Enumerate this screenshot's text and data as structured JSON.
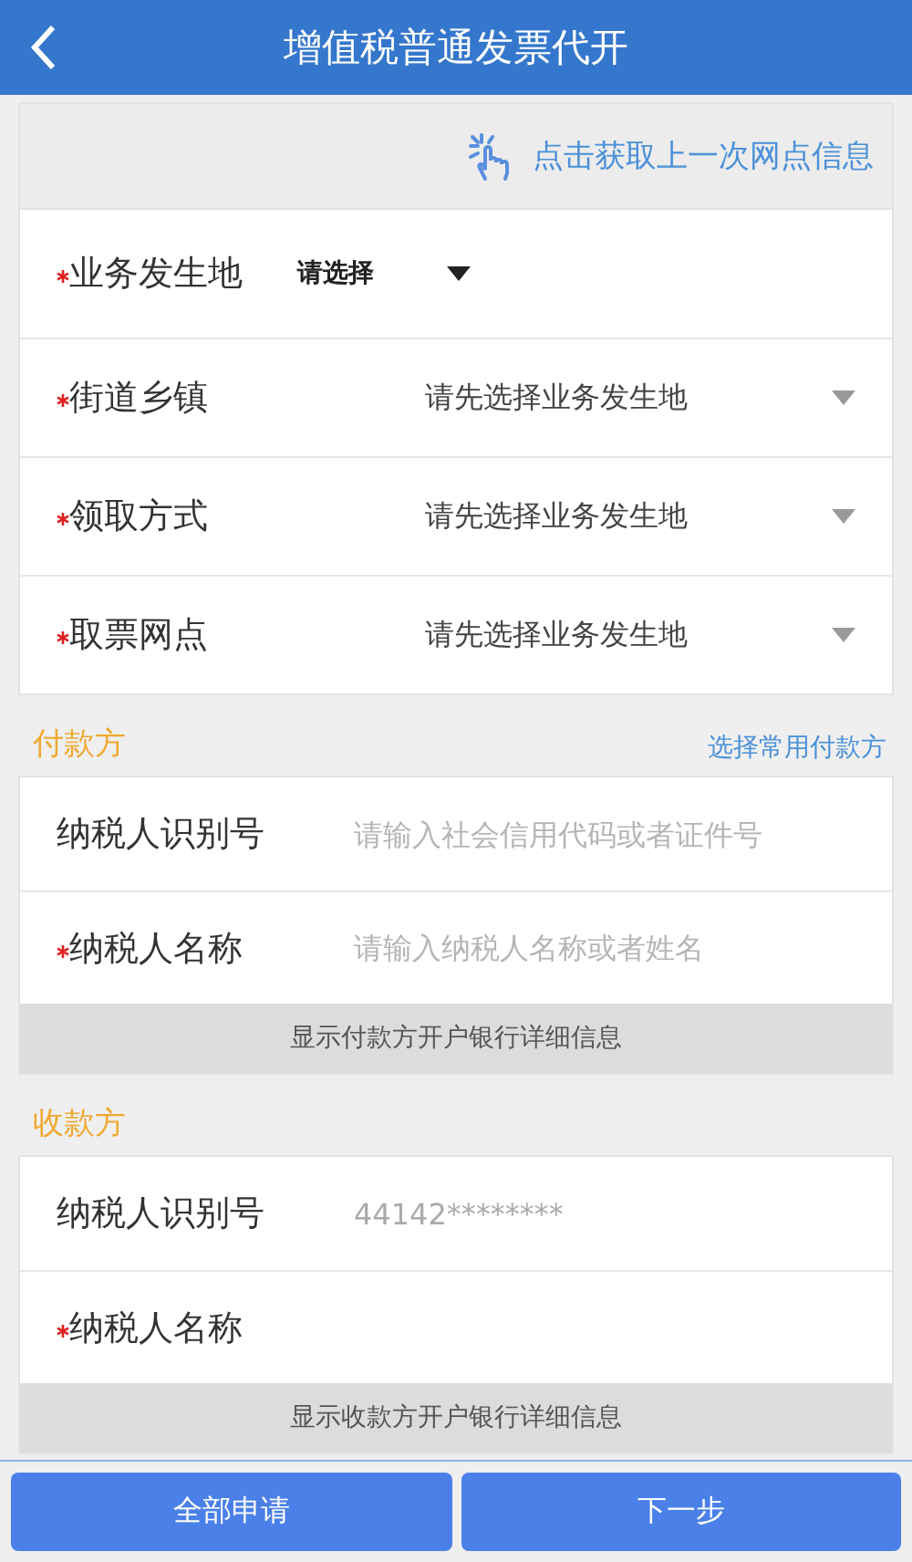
{
  "header": {
    "title": "增值税普通发票代开"
  },
  "history_link": {
    "label": "点击获取上一次网点信息"
  },
  "location_fields": [
    {
      "label": "业务发生地",
      "required": true,
      "value": "请选择"
    },
    {
      "label": "街道乡镇",
      "required": true,
      "placeholder": "请先选择业务发生地"
    },
    {
      "label": "领取方式",
      "required": true,
      "placeholder": "请先选择业务发生地"
    },
    {
      "label": "取票网点",
      "required": true,
      "placeholder": "请先选择业务发生地"
    }
  ],
  "payer": {
    "title": "付款方",
    "action": "选择常用付款方",
    "fields": [
      {
        "label": "纳税人识别号",
        "required": false,
        "placeholder": "请输入社会信用代码或者证件号"
      },
      {
        "label": "纳税人名称",
        "required": true,
        "placeholder": "请输入纳税人名称或者姓名"
      }
    ],
    "bank_toggle": "显示付款方开户银行详细信息"
  },
  "payee": {
    "title": "收款方",
    "fields": [
      {
        "label": "纳税人识别号",
        "required": false,
        "value": "44142********"
      },
      {
        "label": "纳税人名称",
        "required": true
      }
    ],
    "bank_toggle": "显示收款方开户银行详细信息"
  },
  "buttons": [
    "全部申请",
    "下一步"
  ]
}
